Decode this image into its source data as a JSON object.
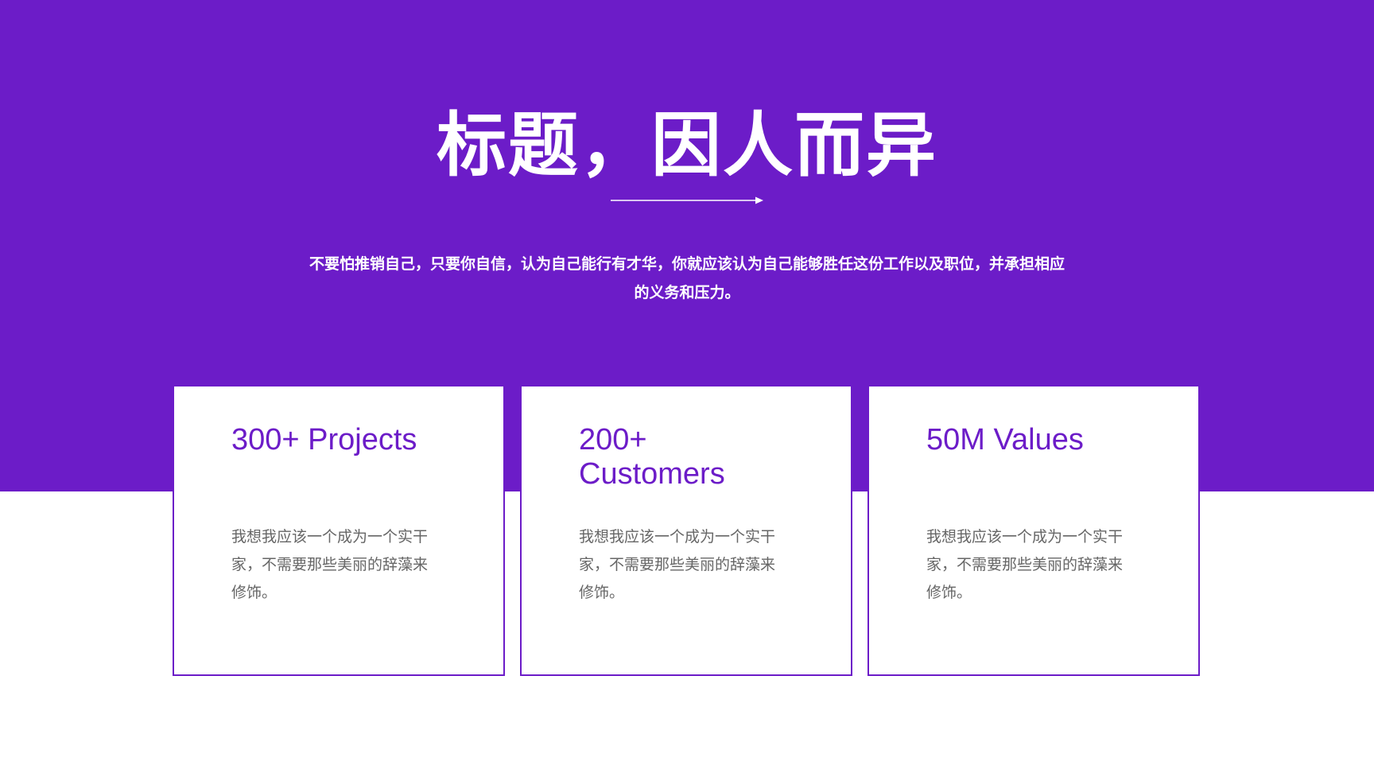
{
  "colors": {
    "accent": "#6c1cc8",
    "background": "#ffffff",
    "body_text": "#666666"
  },
  "hero": {
    "title": "标题，因人而异",
    "subtitle_line1": "不要怕推销自己，只要你自信，认为自己能行有才华，你就应该认为自己能够胜任这份工作以及职位，并承担相应",
    "subtitle_line2": "的义务和压力。",
    "arrow_icon": "arrow-right-icon"
  },
  "cards": [
    {
      "heading_line1": "300+ Projects",
      "heading_line2": "",
      "body_line1": "我想我应该一个成为一个实干",
      "body_line2": "家，不需要那些美丽的辞藻来",
      "body_line3": "修饰。"
    },
    {
      "heading_line1": "200+",
      "heading_line2": "Customers",
      "body_line1": "我想我应该一个成为一个实干",
      "body_line2": "家，不需要那些美丽的辞藻来",
      "body_line3": "修饰。"
    },
    {
      "heading_line1": "50M Values",
      "heading_line2": "",
      "body_line1": "我想我应该一个成为一个实干",
      "body_line2": "家，不需要那些美丽的辞藻来",
      "body_line3": "修饰。"
    }
  ]
}
